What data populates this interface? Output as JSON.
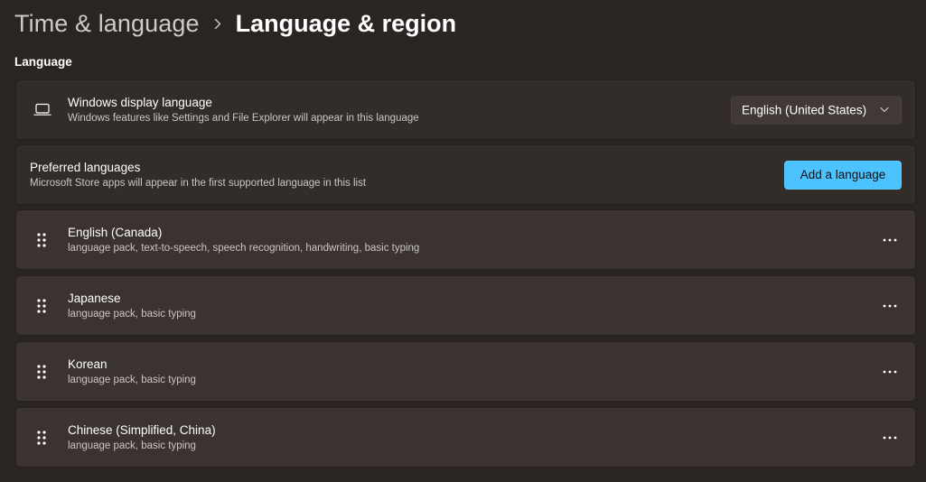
{
  "breadcrumb": {
    "parent": "Time & language",
    "current": "Language & region"
  },
  "section": {
    "language_label": "Language"
  },
  "display_language": {
    "title": "Windows display language",
    "subtitle": "Windows features like Settings and File Explorer will appear in this language",
    "selected": "English (United States)",
    "icon": "laptop-icon"
  },
  "preferred": {
    "title": "Preferred languages",
    "subtitle": "Microsoft Store apps will appear in the first supported language in this list",
    "add_button": "Add a language"
  },
  "languages": [
    {
      "name": "English (Canada)",
      "features": "language pack, text-to-speech, speech recognition, handwriting, basic typing"
    },
    {
      "name": "Japanese",
      "features": "language pack, basic typing"
    },
    {
      "name": "Korean",
      "features": "language pack, basic typing"
    },
    {
      "name": "Chinese (Simplified, China)",
      "features": "language pack, basic typing"
    }
  ],
  "colors": {
    "background": "#2a2522",
    "card": "#332d2a",
    "accent": "#4cc2ff"
  }
}
